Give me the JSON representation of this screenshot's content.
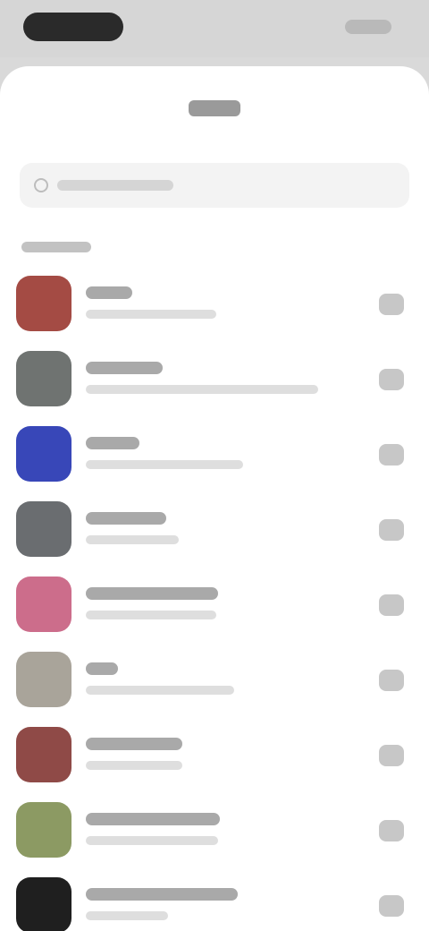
{
  "screen": {
    "title": "",
    "search_placeholder": "",
    "section_header": ""
  },
  "colors": {
    "status_bar": "#d6d6d6",
    "sheet_background": "#ffffff",
    "search_background": "#f3f3f3"
  },
  "apps": [
    {
      "name": "",
      "subtitle": "",
      "icon_color": "#a44b44"
    },
    {
      "name": "",
      "subtitle": "",
      "icon_color": "#6f7371"
    },
    {
      "name": "",
      "subtitle": "",
      "icon_color": "#3847b8"
    },
    {
      "name": "",
      "subtitle": "",
      "icon_color": "#6a6d70"
    },
    {
      "name": "",
      "subtitle": "",
      "icon_color": "#cc6d8b"
    },
    {
      "name": "",
      "subtitle": "",
      "icon_color": "#a9a49a"
    },
    {
      "name": "",
      "subtitle": "",
      "icon_color": "#8f4a47"
    },
    {
      "name": "",
      "subtitle": "",
      "icon_color": "#8c9a63"
    },
    {
      "name": "",
      "subtitle": "",
      "icon_color": "#1f1f1f"
    }
  ]
}
